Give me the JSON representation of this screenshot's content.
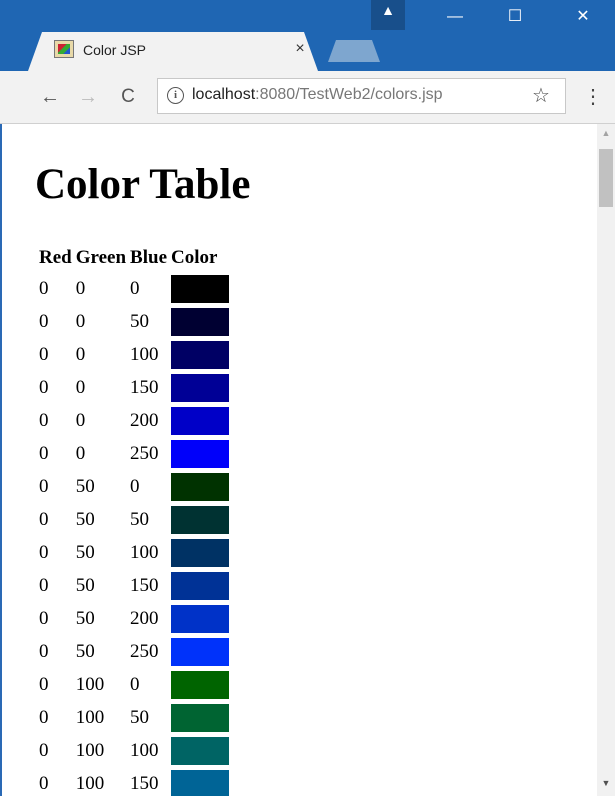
{
  "browser": {
    "tab_title": "Color JSP",
    "tab_close": "×",
    "profile_glyph": "▲",
    "win_min": "—",
    "win_max": "☐",
    "win_close": "✕",
    "back": "←",
    "forward": "→",
    "reload": "C",
    "url_host": "localhost",
    "url_path": ":8080/TestWeb2/colors.jsp",
    "info_glyph": "i",
    "star": "☆",
    "menu": "⋮"
  },
  "page": {
    "heading": "Color Table",
    "headers": [
      "Red",
      "Green",
      "Blue",
      "Color"
    ],
    "rows": [
      {
        "red": "0",
        "green": "0",
        "blue": "0",
        "color": "#000000"
      },
      {
        "red": "0",
        "green": "0",
        "blue": "50",
        "color": "#000032"
      },
      {
        "red": "0",
        "green": "0",
        "blue": "100",
        "color": "#000064"
      },
      {
        "red": "0",
        "green": "0",
        "blue": "150",
        "color": "#000096"
      },
      {
        "red": "0",
        "green": "0",
        "blue": "200",
        "color": "#0000c8"
      },
      {
        "red": "0",
        "green": "0",
        "blue": "250",
        "color": "#0000fa"
      },
      {
        "red": "0",
        "green": "50",
        "blue": "0",
        "color": "#003200"
      },
      {
        "red": "0",
        "green": "50",
        "blue": "50",
        "color": "#003232"
      },
      {
        "red": "0",
        "green": "50",
        "blue": "100",
        "color": "#003264"
      },
      {
        "red": "0",
        "green": "50",
        "blue": "150",
        "color": "#003296"
      },
      {
        "red": "0",
        "green": "50",
        "blue": "200",
        "color": "#0032c8"
      },
      {
        "red": "0",
        "green": "50",
        "blue": "250",
        "color": "#0032fa"
      },
      {
        "red": "0",
        "green": "100",
        "blue": "0",
        "color": "#006400"
      },
      {
        "red": "0",
        "green": "100",
        "blue": "50",
        "color": "#006432"
      },
      {
        "red": "0",
        "green": "100",
        "blue": "100",
        "color": "#006464"
      },
      {
        "red": "0",
        "green": "100",
        "blue": "150",
        "color": "#006496"
      }
    ]
  },
  "icons": {
    "favicon": "tomcat-favicon",
    "profile": "person-icon",
    "info": "info-icon",
    "bookmark": "star-icon",
    "menu": "kebab-menu-icon"
  }
}
